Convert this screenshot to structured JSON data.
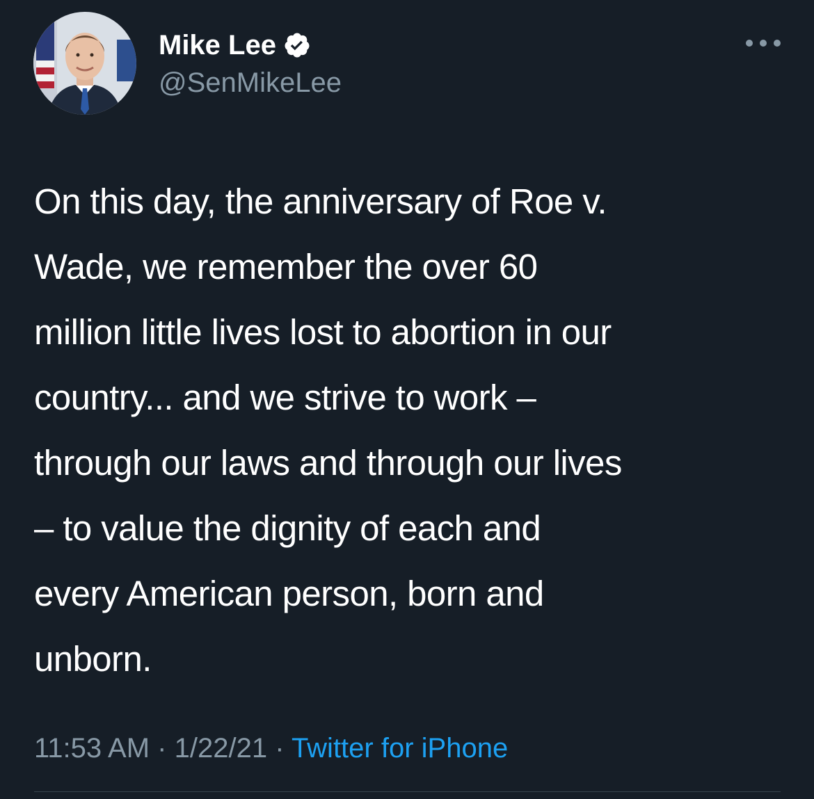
{
  "author": {
    "display_name": "Mike Lee",
    "handle": "@SenMikeLee",
    "verified": true,
    "avatar_icon": "profile-photo"
  },
  "tweet": {
    "lines": [
      "On this day, the anniversary of Roe v.",
      "Wade, we remember the over 60",
      "million little lives lost to abortion in our",
      "country... and we strive to work –",
      "through our laws and through our lives",
      "– to value the dignity of each and",
      "every American person, born and",
      "unborn."
    ]
  },
  "meta": {
    "time": "11:53 AM",
    "separator": "·",
    "date": "1/22/21",
    "source": "Twitter for iPhone"
  },
  "colors": {
    "background": "#161e27",
    "text": "#ffffff",
    "secondary": "#8899a6",
    "link": "#1da1f2"
  },
  "icons": {
    "more": "more-horizontal-icon",
    "verified": "verified-badge-icon"
  }
}
